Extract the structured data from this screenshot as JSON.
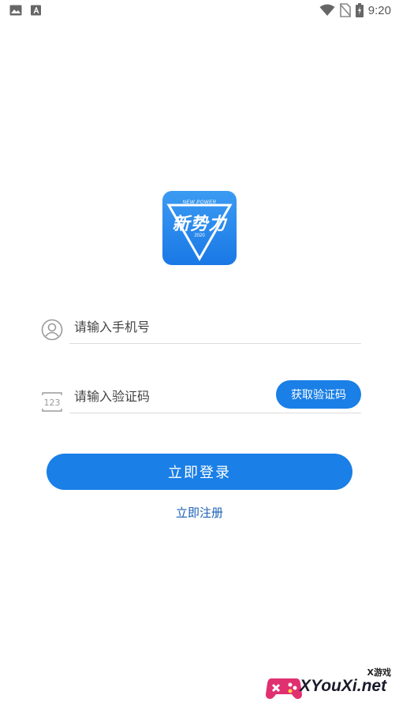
{
  "status_bar": {
    "time": "9:20",
    "left_icons": [
      "image-icon",
      "text-a-icon"
    ],
    "right_icons": [
      "wifi-icon",
      "no-sim-icon",
      "battery-icon"
    ]
  },
  "logo": {
    "tagline": "NEW POWER",
    "name": "新势力",
    "year": "2020"
  },
  "form": {
    "phone_placeholder": "请输入手机号",
    "code_placeholder": "请输入验证码",
    "code_icon_text": "123",
    "get_code_label": "获取验证码",
    "login_label": "立即登录",
    "register_label": "立即注册"
  },
  "watermark": {
    "small_text": "X游戏",
    "brand_text": "XYouXi.net"
  },
  "colors": {
    "primary": "#1a7fe6",
    "link": "#1a5fb4",
    "watermark_pink": "#e0306f"
  }
}
